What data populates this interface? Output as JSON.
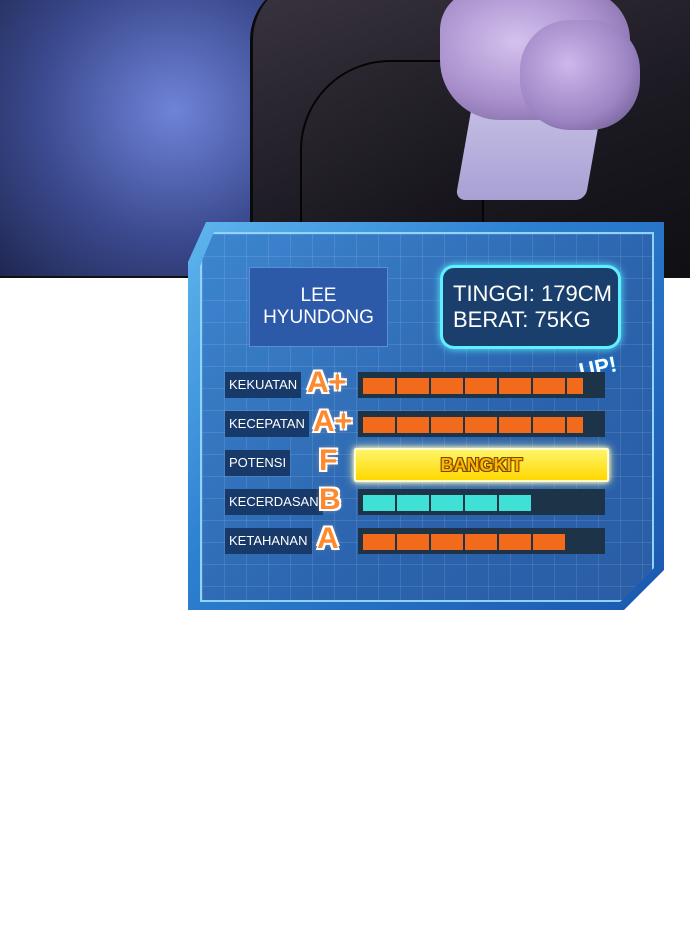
{
  "profile": {
    "name_line1": "LEE",
    "name_line2": "HYUNDONG",
    "height": "TINGGI: 179CM",
    "weight": "BERAT: 75KG"
  },
  "badge": "UP!",
  "stats": [
    {
      "label": "KEKUATAN",
      "grade": "A+",
      "level": 6.5,
      "max": 7,
      "color": "#f26a1b"
    },
    {
      "label": "KECEPATAN",
      "grade": "A+",
      "level": 6.5,
      "max": 7,
      "color": "#f26a1b"
    },
    {
      "label": "POTENSI",
      "grade": "F",
      "bar_text": "BANGKIT",
      "color": "#ffd800"
    },
    {
      "label": "KECERDASAN",
      "grade": "B",
      "level": 5,
      "max": 7,
      "color": "#3fe0d6"
    },
    {
      "label": "KETAHANAN",
      "grade": "A",
      "level": 6,
      "max": 7,
      "color": "#f26a1b"
    }
  ],
  "colors": {
    "accent": "#5ef0ff",
    "bar_orange": "#f26a1b",
    "bar_teal": "#3fe0d6",
    "bar_yellow": "#ffd800"
  }
}
